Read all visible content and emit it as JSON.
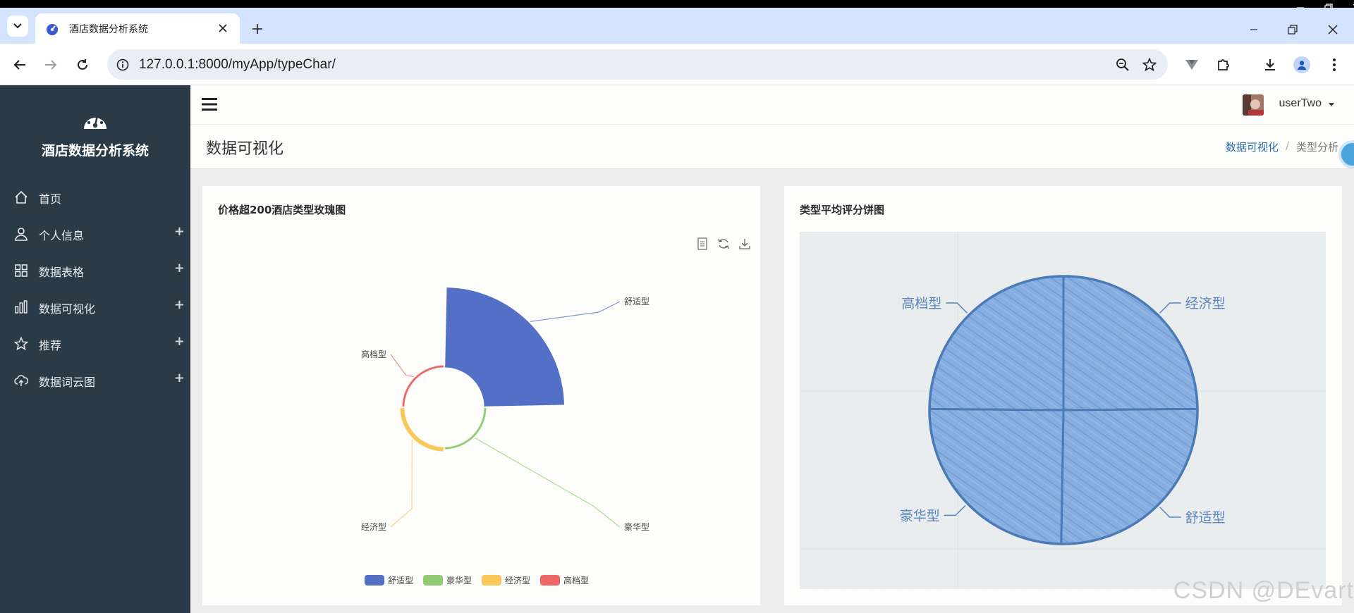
{
  "browser": {
    "tab_title": "酒店数据分析系统",
    "url": "127.0.0.1:8000/myApp/typeChar/"
  },
  "sidebar": {
    "brand": "酒店数据分析系统",
    "items": [
      {
        "label": "首页",
        "icon": "home-icon",
        "expandable": false
      },
      {
        "label": "个人信息",
        "icon": "user-icon",
        "expandable": true
      },
      {
        "label": "数据表格",
        "icon": "grid-icon",
        "expandable": true
      },
      {
        "label": "数据可视化",
        "icon": "bar-chart-icon",
        "expandable": true
      },
      {
        "label": "推荐",
        "icon": "star-icon",
        "expandable": true
      },
      {
        "label": "数据词云图",
        "icon": "cloud-upload-icon",
        "expandable": true
      }
    ],
    "plus": "+"
  },
  "header": {
    "user_name": "userTwo"
  },
  "page": {
    "title": "数据可视化",
    "breadcrumb": {
      "link": "数据可视化",
      "separator": "/",
      "current": "类型分析"
    }
  },
  "rose_card": {
    "title": "价格超200酒店类型玫瑰图"
  },
  "pie_card": {
    "title": "类型平均评分饼图"
  },
  "watermark": "CSDN @DEvart",
  "colors": {
    "sidebar_bg": "#2a3a47",
    "comfort": "#5470c6",
    "luxury": "#91cc75",
    "economy": "#fac858",
    "premium": "#ee6666",
    "pie_blue": "#4a7bb7"
  },
  "chart_data": [
    {
      "type": "pie",
      "variant": "rose",
      "categories": [
        "舒适型",
        "豪华型",
        "经济型",
        "高档型"
      ],
      "values": [
        100,
        1,
        5,
        1
      ],
      "legend": [
        "舒适型",
        "豪华型",
        "经济型",
        "高档型"
      ],
      "legend_position": "bottom"
    },
    {
      "type": "pie",
      "categories": [
        "经济型",
        "舒适型",
        "豪华型",
        "高档型"
      ],
      "values": [
        4.6,
        4.7,
        4.6,
        4.6
      ]
    }
  ]
}
